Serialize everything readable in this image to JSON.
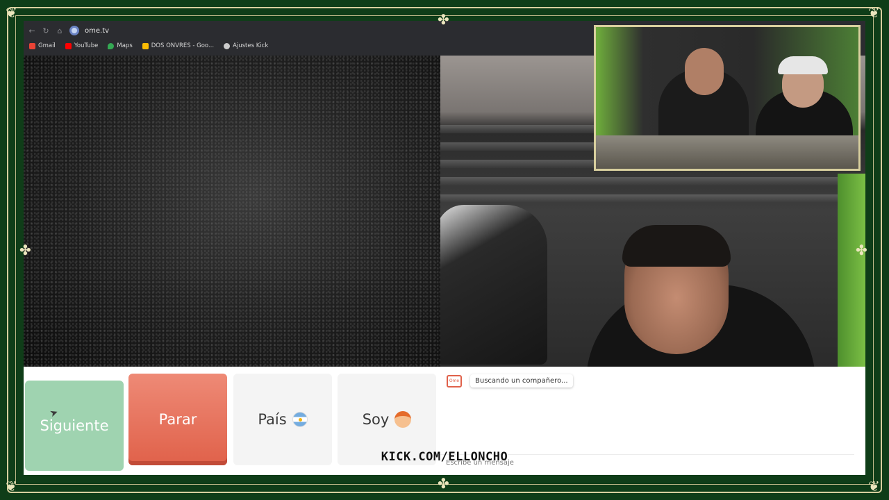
{
  "browser": {
    "url": "ome.tv",
    "bookmarks": [
      {
        "label": "Gmail",
        "icon": "gmail-icon",
        "color": "#ea4335"
      },
      {
        "label": "YouTube",
        "icon": "youtube-icon",
        "color": "#ff0000"
      },
      {
        "label": "Maps",
        "icon": "maps-icon",
        "color": "#34a853"
      },
      {
        "label": "DOS ONVRES - Goo...",
        "icon": "drive-icon",
        "color": "#fbbc04"
      },
      {
        "label": "Ajustes Kick",
        "icon": "kick-icon",
        "color": "#cccccc"
      }
    ]
  },
  "controls": {
    "next_label": "Siguiente",
    "stop_label": "Parar",
    "country_label": "País",
    "country_flag": "argentina-flag-icon",
    "gender_label": "Soy",
    "gender_icon": "boy-avatar-icon"
  },
  "chat": {
    "status_message": "Buscando un compañero...",
    "input_placeholder": "Escribe un mensaje"
  },
  "overlay": {
    "watermark": "KICK.COM/ELLONCHO"
  },
  "colors": {
    "next_button": "#9fd3b0",
    "stop_button": "#e0614a",
    "frame_green": "#0f3d18",
    "frame_gold": "#d8cf9e"
  }
}
